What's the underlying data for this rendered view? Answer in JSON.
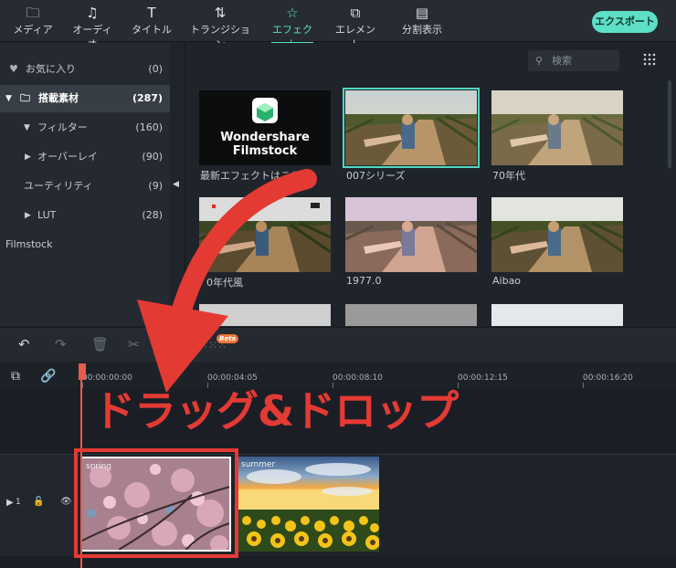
{
  "topbar": {
    "tabs": [
      {
        "label": "メディア",
        "icon": "folder-icon"
      },
      {
        "label": "オーディオ",
        "icon": "music-note-icon"
      },
      {
        "label": "タイトル",
        "icon": "text-icon"
      },
      {
        "label": "トランジション",
        "icon": "transition-icon"
      },
      {
        "label": "エフェクト",
        "icon": "effect-icon",
        "active": true
      },
      {
        "label": "エレメント",
        "icon": "element-icon"
      },
      {
        "label": "分割表示",
        "icon": "split-screen-icon"
      }
    ],
    "export_label": "エクスポート"
  },
  "sidebar": {
    "items": [
      {
        "label": "お気に入り",
        "count": "(0)",
        "icon": "heart-icon"
      },
      {
        "label": "搭載素材",
        "count": "(287)",
        "icon": "folder-icon",
        "selected": true
      },
      {
        "label": "フィルター",
        "count": "(160)"
      },
      {
        "label": "オーバーレイ",
        "count": "(90)"
      },
      {
        "label": "ユーティリティ",
        "count": "(9)"
      },
      {
        "label": "LUT",
        "count": "(28)"
      },
      {
        "label": "Filmstock",
        "count": ""
      }
    ]
  },
  "search": {
    "placeholder": "検索"
  },
  "effects": [
    {
      "caption": "最新エフェクトはこちら",
      "brand": "Wondershare Filmstock"
    },
    {
      "caption": "007シリーズ"
    },
    {
      "caption": "70年代"
    },
    {
      "caption": "0年代風"
    },
    {
      "caption": "1977.0"
    },
    {
      "caption": "Aibao"
    }
  ],
  "timeline": {
    "timecodes": [
      "00:00:00:00",
      "00:00:04:05",
      "00:00:08:10",
      "00:00:12:15",
      "00:00:16:20"
    ],
    "beta_badge": "Beta",
    "track_number": "1",
    "clips": [
      {
        "label": "spring"
      },
      {
        "label": "summer"
      }
    ]
  },
  "overlay_text": "ドラッグ&ドロップ",
  "colors": {
    "accent": "#5fe0c8",
    "annotation_red": "#e43a34",
    "playhead": "#e85a4a"
  }
}
